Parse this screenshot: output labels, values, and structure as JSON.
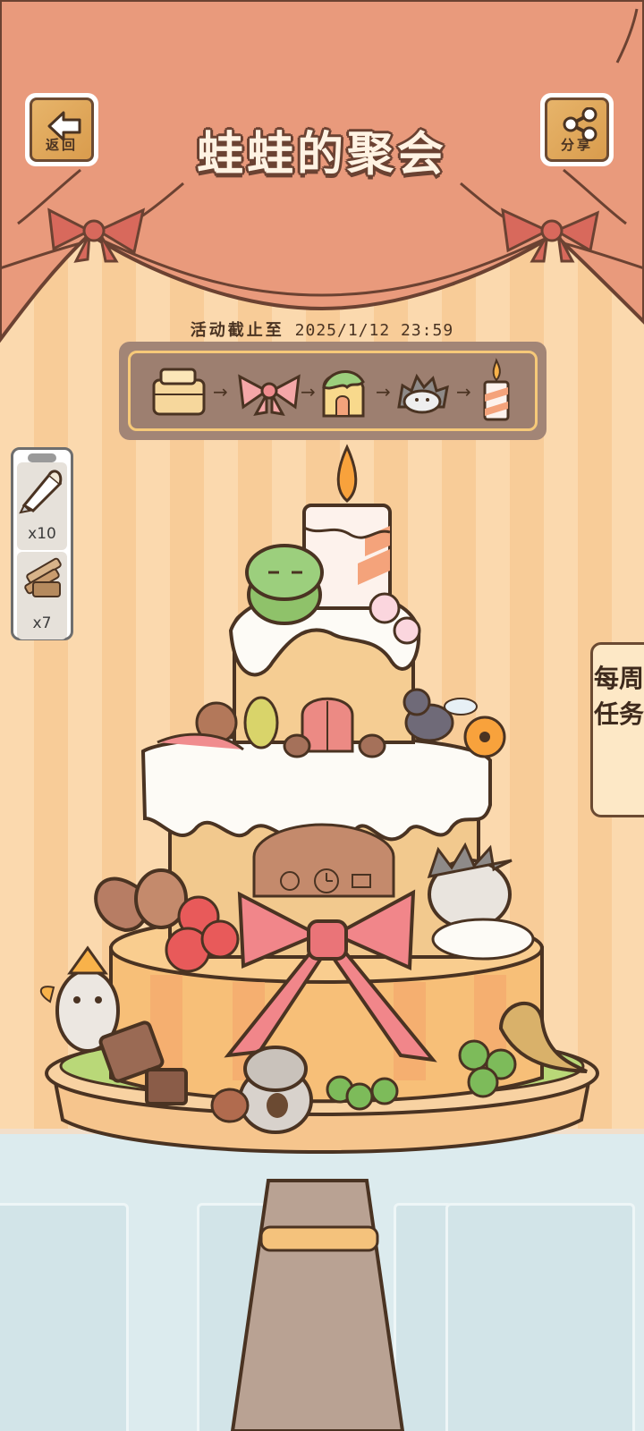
{
  "header": {
    "back_label": "返回",
    "title": "蛙蛙的聚会",
    "share_label": "分享"
  },
  "event": {
    "deadline_label": "活动截止至",
    "deadline_value": "2025/1/12  23:59"
  },
  "progress_steps": [
    {
      "icon": "cake-base-icon"
    },
    {
      "icon": "bow-icon"
    },
    {
      "icon": "cake-house-icon"
    },
    {
      "icon": "hedgehog-icon"
    },
    {
      "icon": "candle-icon"
    }
  ],
  "inventory": [
    {
      "icon": "piping-bag-icon",
      "count": "x10"
    },
    {
      "icon": "wafer-sticks-icon",
      "count": "x7"
    }
  ],
  "weekly_tasks": {
    "label": "每周任务"
  },
  "colors": {
    "curtain": "#e99a7c",
    "curtain_outline": "#6b4232",
    "wall_stripe_light": "#fbd9ae",
    "wall_stripe_dark": "#f8cc98",
    "wood_button": "#e1aa5d"
  }
}
